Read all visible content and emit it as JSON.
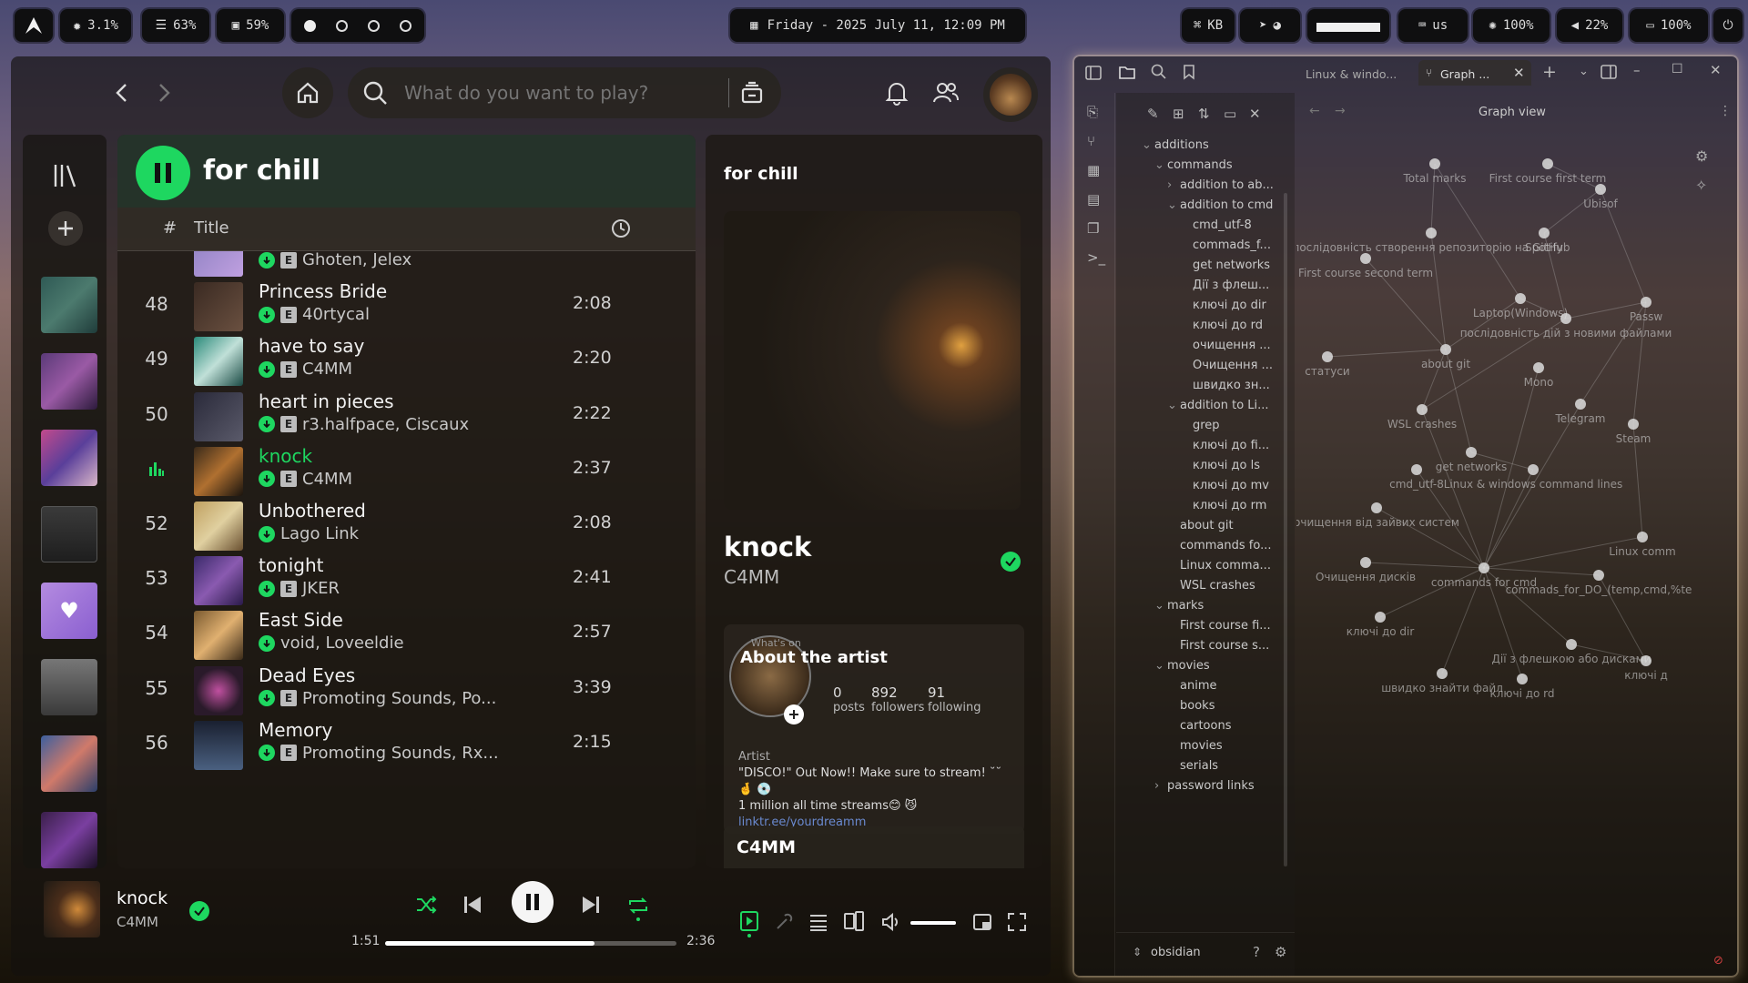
{
  "topbar": {
    "cpu": "3.1%",
    "memory": "63%",
    "disk": "59%",
    "datetime": "Friday - 2025 July 11, 12:09 PM",
    "kb_label": "KB",
    "layout": "us",
    "brightness": "100%",
    "volume": "22%",
    "battery": "100%"
  },
  "spotify": {
    "search_placeholder": "What do you want to play?",
    "playlist_title": "for chill",
    "col_num": "#",
    "col_title": "Title",
    "tracks": [
      {
        "num": "",
        "title": "",
        "artist": "Ghoten, Jelex",
        "dur": "",
        "explicit": true,
        "dl": true
      },
      {
        "num": "48",
        "title": "Princess Bride",
        "artist": "40rtycal",
        "dur": "2:08",
        "explicit": true,
        "dl": true
      },
      {
        "num": "49",
        "title": "have to say",
        "artist": "C4MM",
        "dur": "2:20",
        "explicit": true,
        "dl": true
      },
      {
        "num": "50",
        "title": "heart in pieces",
        "artist": "r3.halfpace, Ciscaux",
        "dur": "2:22",
        "explicit": true,
        "dl": true
      },
      {
        "num": "",
        "title": "knock",
        "artist": "C4MM",
        "dur": "2:37",
        "explicit": true,
        "dl": true,
        "playing": true
      },
      {
        "num": "52",
        "title": "Unbothered",
        "artist": "Lago Link",
        "dur": "2:08",
        "explicit": false,
        "dl": true
      },
      {
        "num": "53",
        "title": "tonight",
        "artist": "JKER",
        "dur": "2:41",
        "explicit": true,
        "dl": true
      },
      {
        "num": "54",
        "title": "East Side",
        "artist": "void, Loveeldie",
        "dur": "2:57",
        "explicit": false,
        "dl": true
      },
      {
        "num": "55",
        "title": "Dead Eyes",
        "artist": "Promoting Sounds, Po...",
        "dur": "3:39",
        "explicit": true,
        "dl": true
      },
      {
        "num": "56",
        "title": "Memory",
        "artist": "Promoting Sounds, Rx...",
        "dur": "2:15",
        "explicit": true,
        "dl": true
      }
    ],
    "right": {
      "header": "for chill",
      "song": "knock",
      "artist": "C4MM",
      "about_heading": "About the artist",
      "whats_on": "What's on",
      "posts_value": "0",
      "posts_label": "posts",
      "followers_value": "892",
      "followers_label": "followers",
      "following_value": "91",
      "following_label": "following",
      "artist_tag": "Artist",
      "bio_1": "\"DISCO!\" Out Now!! Make sure to stream! ˘˘",
      "bio_2": "🤞 💿",
      "bio_3": "1 million all time streams😊 😼",
      "bio_link": "linktr.ee/yourdreamm",
      "footer_artist": "C4MM"
    },
    "player": {
      "title": "knock",
      "artist": "C4MM",
      "elapsed": "1:51",
      "total": "2:36",
      "progress": 0.72,
      "volume": 1.0
    }
  },
  "obsidian": {
    "tabs": [
      "Linux & windo...",
      "Graph ..."
    ],
    "graph_title": "Graph view",
    "vault": "obsidian",
    "tree": [
      {
        "label": "additions",
        "depth": 0,
        "arrow": "down"
      },
      {
        "label": "commands",
        "depth": 1,
        "arrow": "down"
      },
      {
        "label": "addition to ab...",
        "depth": 2,
        "arrow": "right"
      },
      {
        "label": "addition to cmd",
        "depth": 2,
        "arrow": "down"
      },
      {
        "label": "cmd_utf-8",
        "depth": 3,
        "arrow": ""
      },
      {
        "label": "commads_f...",
        "depth": 3,
        "arrow": ""
      },
      {
        "label": "get networks",
        "depth": 3,
        "arrow": ""
      },
      {
        "label": "Дії з флеш...",
        "depth": 3,
        "arrow": ""
      },
      {
        "label": "ключі до dir",
        "depth": 3,
        "arrow": ""
      },
      {
        "label": "ключі до rd",
        "depth": 3,
        "arrow": ""
      },
      {
        "label": "очищення ...",
        "depth": 3,
        "arrow": ""
      },
      {
        "label": "Очищення ...",
        "depth": 3,
        "arrow": ""
      },
      {
        "label": "швидко зн...",
        "depth": 3,
        "arrow": ""
      },
      {
        "label": "addition to Li...",
        "depth": 2,
        "arrow": "down"
      },
      {
        "label": "grep",
        "depth": 3,
        "arrow": ""
      },
      {
        "label": "ключі до fi...",
        "depth": 3,
        "arrow": ""
      },
      {
        "label": "ключі до ls",
        "depth": 3,
        "arrow": ""
      },
      {
        "label": "ключі до mv",
        "depth": 3,
        "arrow": ""
      },
      {
        "label": "ключі до rm",
        "depth": 3,
        "arrow": ""
      },
      {
        "label": "about git",
        "depth": 2,
        "arrow": ""
      },
      {
        "label": "commands fo...",
        "depth": 2,
        "arrow": ""
      },
      {
        "label": "Linux comma...",
        "depth": 2,
        "arrow": ""
      },
      {
        "label": "WSL crashes",
        "depth": 2,
        "arrow": ""
      },
      {
        "label": "marks",
        "depth": 1,
        "arrow": "down"
      },
      {
        "label": "First course fi...",
        "depth": 2,
        "arrow": ""
      },
      {
        "label": "First course s...",
        "depth": 2,
        "arrow": ""
      },
      {
        "label": "movies",
        "depth": 1,
        "arrow": "down"
      },
      {
        "label": "anime",
        "depth": 2,
        "arrow": ""
      },
      {
        "label": "books",
        "depth": 2,
        "arrow": ""
      },
      {
        "label": "cartoons",
        "depth": 2,
        "arrow": ""
      },
      {
        "label": "movies",
        "depth": 2,
        "arrow": ""
      },
      {
        "label": "serials",
        "depth": 2,
        "arrow": ""
      },
      {
        "label": "password links",
        "depth": 1,
        "arrow": "right"
      }
    ],
    "graph_nodes": [
      "Total marks",
      "First course first term",
      "Ubisof",
      "послідовність створення репозиторію на GitHub",
      "Spotify",
      "First course second term",
      "Laptop(Windows)",
      "Passw",
      "послідовність дій з новими файлами",
      "статуси",
      "about git",
      "Mono",
      "WSL crashes",
      "Telegram",
      "Steam",
      "get networks",
      "cmd_utf-8",
      "Linux & windows command lines",
      "очищення від зайвих систем",
      "Linux comm",
      "Очищення дисків",
      "commands for cmd",
      "commads_for_DO_(temp,cmd,%te",
      "ключі до dir",
      "Дії з флешкою або дисками",
      "ключі д",
      "швидко знайти файл",
      "ключі до rd"
    ]
  },
  "colors": {
    "accent": "#1ed760",
    "bar": "#0f0f10"
  }
}
